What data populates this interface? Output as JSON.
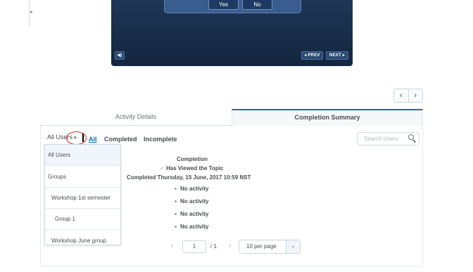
{
  "player": {
    "dialog_buttons": [
      "Yes",
      "No"
    ],
    "prev_label": "◂ PREV",
    "next_label": "NEXT ▸",
    "volume_icon": "speaker-icon"
  },
  "pager": {
    "prev": "‹",
    "next": "›"
  },
  "tabs": [
    {
      "label": "Activity Details",
      "active": false
    },
    {
      "label": "Completion Summary",
      "active": true
    }
  ],
  "users_select": {
    "value": "All Users"
  },
  "filters": [
    {
      "label": "All",
      "active": true
    },
    {
      "label": "Completed",
      "active": false
    },
    {
      "label": "Incomplete",
      "active": false
    }
  ],
  "search": {
    "placeholder": "Search Users"
  },
  "dropdown": {
    "options": [
      "All Users",
      "Groups",
      "Workshop 1st semester",
      "Group 1",
      "Workshop June group"
    ],
    "selected": "All Users"
  },
  "completion": {
    "heading": "Completion",
    "viewed": "Has Viewed the Topic",
    "completed_line": "Completed Thursday, 15 June, 2017 10:59 NST",
    "rows": [
      "No activity",
      "No activity",
      "No activity",
      "No activity"
    ]
  },
  "pagination": {
    "prev": "‹",
    "next": "›",
    "current_page": "1",
    "total": "/ 1",
    "per_page": "10 per page"
  },
  "colors": {
    "accent": "#006fbf",
    "highlight_circle": "#d9251c",
    "player_bg": "#1a2e4a"
  }
}
